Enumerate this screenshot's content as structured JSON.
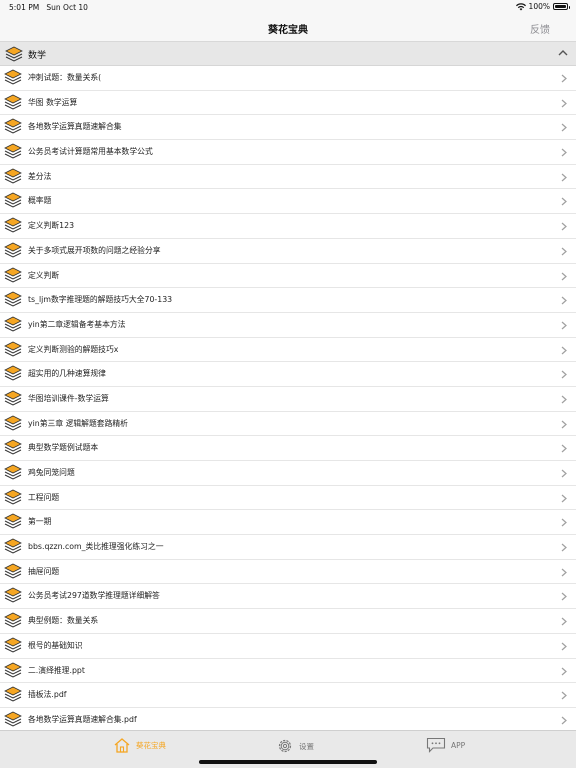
{
  "status": {
    "time": "5:01 PM",
    "date": "Sun Oct 10",
    "battery": "100%"
  },
  "nav": {
    "title": "葵花宝典",
    "feedback": "反馈"
  },
  "section": {
    "title": "数学"
  },
  "items": [
    "冲刺试题：数量关系(",
    "华图  数学运算",
    "各地数学运算真题速解合集",
    "公务员考试计算题常用基本数学公式",
    "差分法",
    "概率题",
    "定义判断123",
    "关于多项式展开项数的问题之经验分享",
    "定义判断",
    "ts_ljm数字推理题的解题技巧大全70-133",
    "yin第二章逻辑备考基本方法",
    "定义判断测验的解题技巧x",
    "超实用的几种速算规律",
    "华图培训课件-数学运算",
    "yin第三章 逻辑解题套路精析",
    "典型数学题例试题本",
    "鸡兔同笼问题",
    "工程问题",
    "第一期",
    "bbs.qzzn.com_类比推理强化练习之一",
    "抽屉问题",
    "公务员考试297道数学推理题详细解答",
    "典型例题：数量关系",
    "根号的基础知识",
    "二.演绎推理.ppt",
    "插板法.pdf",
    "各地数学运算真题速解合集.pdf"
  ],
  "tabs": {
    "home": "葵花宝典",
    "settings": "设置",
    "app": "APP"
  },
  "colors": {
    "accent": "#f5a623",
    "inactive": "#777777"
  }
}
